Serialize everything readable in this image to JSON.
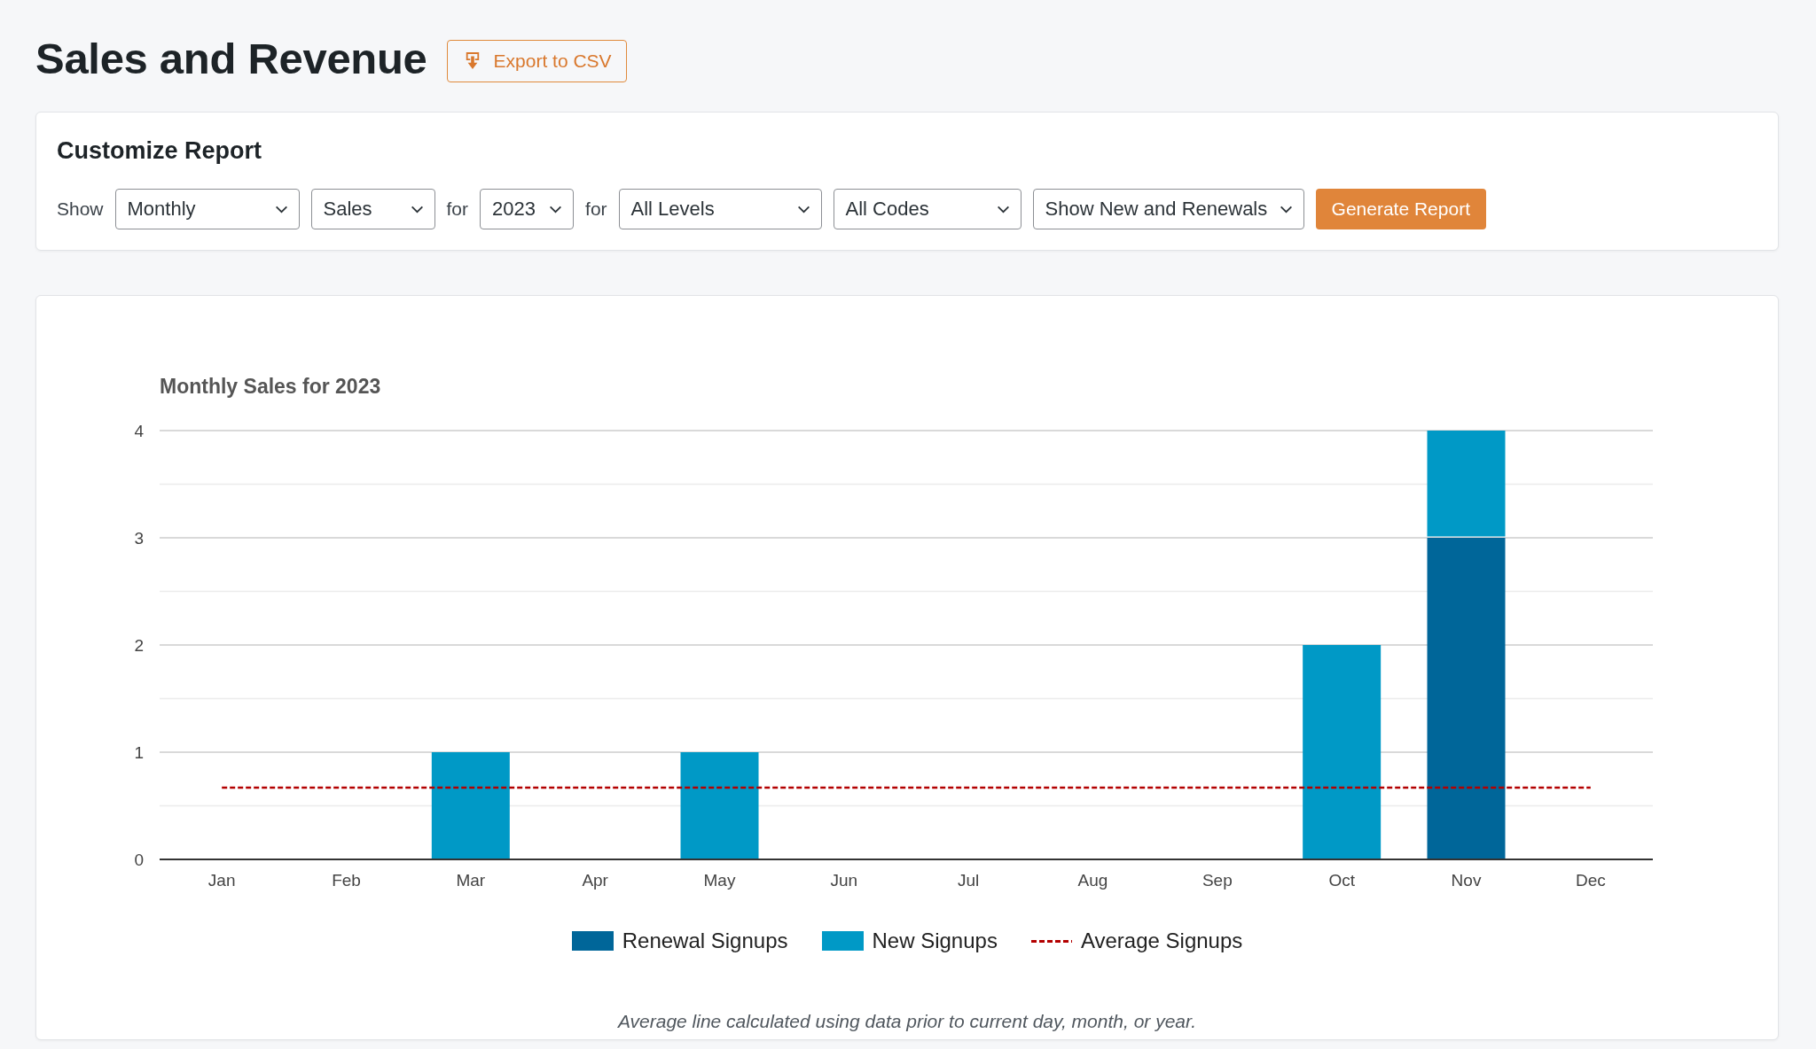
{
  "page": {
    "title": "Sales and Revenue",
    "export_button": {
      "label": "Export to CSV"
    }
  },
  "customize_report": {
    "heading": "Customize Report",
    "controls": [
      {
        "kind": "label",
        "text": "Show"
      },
      {
        "kind": "select",
        "value": "Monthly"
      },
      {
        "kind": "select",
        "value": "Sales"
      },
      {
        "kind": "label",
        "text": "for"
      },
      {
        "kind": "select",
        "value": "2023"
      },
      {
        "kind": "label",
        "text": "for"
      },
      {
        "kind": "select",
        "value": "All Levels"
      },
      {
        "kind": "select",
        "value": "All Codes"
      },
      {
        "kind": "select",
        "value": "Show New and Renewals"
      },
      {
        "kind": "button",
        "label": "Generate Report"
      }
    ]
  },
  "report": {
    "chart_data": {
      "type": "bar",
      "title": "Monthly Sales for 2023",
      "categories": [
        "Jan",
        "Feb",
        "Mar",
        "Apr",
        "May",
        "Jun",
        "Jul",
        "Aug",
        "Sep",
        "Oct",
        "Nov",
        "Dec"
      ],
      "stacked": true,
      "grid": true,
      "ylim": [
        0,
        4
      ],
      "yticks": [
        0,
        1,
        2,
        3,
        4
      ],
      "series": [
        {
          "name": "Renewal Signups",
          "type": "bar",
          "color": "#006699",
          "values": [
            0,
            0,
            0,
            0,
            0,
            0,
            0,
            0,
            0,
            0,
            3,
            0
          ]
        },
        {
          "name": "New Signups",
          "type": "bar",
          "color": "#0099c6",
          "values": [
            0,
            0,
            1,
            0,
            1,
            0,
            0,
            0,
            0,
            2,
            1,
            0
          ]
        },
        {
          "name": "Average Signups",
          "type": "line",
          "line_style": "dashed",
          "color": "#b30000",
          "values": [
            0.67,
            0.67,
            0.67,
            0.67,
            0.67,
            0.67,
            0.67,
            0.67,
            0.67,
            0.67,
            0.67,
            0.67
          ]
        }
      ]
    },
    "note": "Average line calculated using data prior to current day, month, or year."
  }
}
